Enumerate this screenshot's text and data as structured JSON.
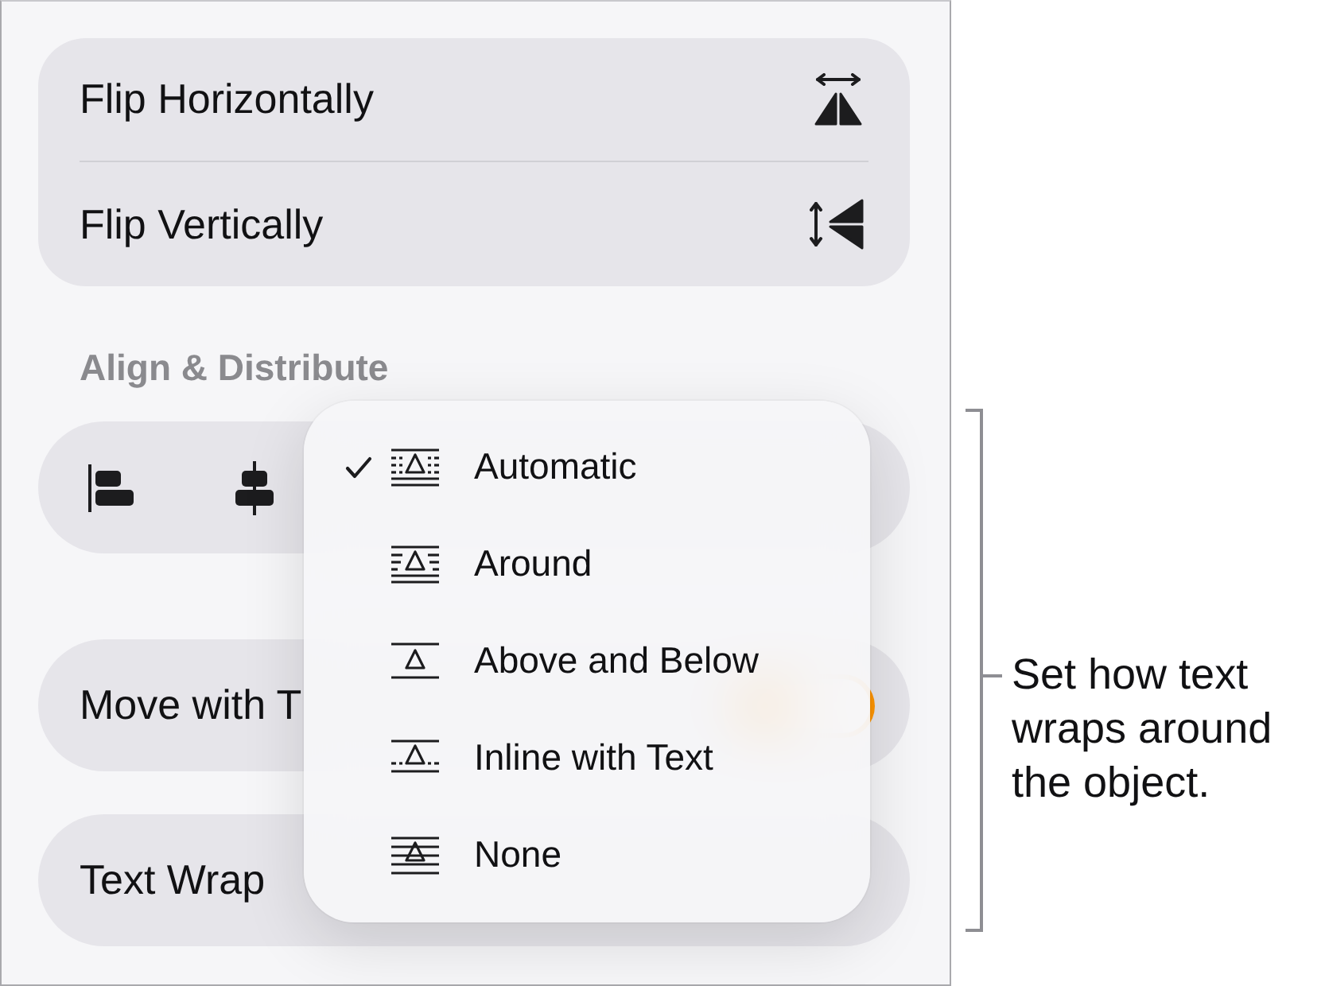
{
  "panel": {
    "flip_options": [
      {
        "label": "Flip Horizontally",
        "kind": "horizontal"
      },
      {
        "label": "Flip Vertically",
        "kind": "vertical"
      }
    ],
    "align_heading": "Align & Distribute",
    "move_with_text": {
      "label": "Move with T",
      "on": true
    },
    "text_wrap": {
      "label": "Text Wrap"
    }
  },
  "wrap_menu": {
    "items": [
      {
        "label": "Automatic",
        "kind": "automatic",
        "selected": true
      },
      {
        "label": "Around",
        "kind": "around",
        "selected": false
      },
      {
        "label": "Above and Below",
        "kind": "above_below",
        "selected": false
      },
      {
        "label": "Inline with Text",
        "kind": "inline",
        "selected": false
      },
      {
        "label": "None",
        "kind": "none",
        "selected": false
      }
    ]
  },
  "callout": {
    "text": "Set how text wraps around the object."
  }
}
